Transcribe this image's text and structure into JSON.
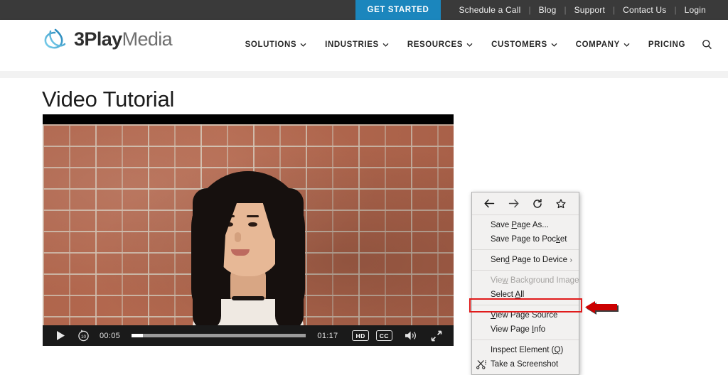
{
  "topbar": {
    "cta_label": "GET STARTED",
    "cta_color": "#1b86bd",
    "background": "#3a3a3a",
    "links": [
      "Schedule a Call",
      "Blog",
      "Support",
      "Contact Us",
      "Login"
    ],
    "separator": "|"
  },
  "header": {
    "logo": {
      "bold_text": "3Play",
      "light_text": "Media",
      "mark_icon": "3play-swirl-logo-icon",
      "mark_color": "#29a3d9"
    },
    "nav": [
      {
        "label": "SOLUTIONS",
        "has_dropdown": true
      },
      {
        "label": "INDUSTRIES",
        "has_dropdown": true
      },
      {
        "label": "RESOURCES",
        "has_dropdown": true
      },
      {
        "label": "CUSTOMERS",
        "has_dropdown": true
      },
      {
        "label": "COMPANY",
        "has_dropdown": true
      },
      {
        "label": "PRICING",
        "has_dropdown": false
      }
    ],
    "chevron_icon": "chevron-down-icon",
    "search_icon": "search-icon"
  },
  "main": {
    "page_title": "Video Tutorial"
  },
  "player": {
    "play_icon": "play-icon",
    "rewind_icon": "rewind-10-icon",
    "current_time": "00:05",
    "duration": "01:17",
    "progress_percent": 6.5,
    "hd_label": "HD",
    "cc_label": "CC",
    "volume_icon": "volume-on-icon",
    "fullscreen_icon": "fullscreen-icon"
  },
  "context_menu": {
    "nav_icons": [
      {
        "name": "back-icon",
        "glyph": "back"
      },
      {
        "name": "forward-icon",
        "glyph": "forward"
      },
      {
        "name": "reload-icon",
        "glyph": "reload"
      },
      {
        "name": "bookmark-star-icon",
        "glyph": "star"
      }
    ],
    "groups": [
      [
        {
          "label": "Save Page As...",
          "accesskey": "P",
          "disabled": false,
          "submenu": false,
          "icon": null
        },
        {
          "label": "Save Page to Pocket",
          "accesskey": "k",
          "disabled": false,
          "submenu": false,
          "icon": null
        }
      ],
      [
        {
          "label": "Send Page to Device",
          "accesskey": "d",
          "disabled": false,
          "submenu": true,
          "icon": null
        }
      ],
      [
        {
          "label": "View Background Image",
          "accesskey": "w",
          "disabled": true,
          "submenu": false,
          "icon": null
        },
        {
          "label": "Select All",
          "accesskey": "A",
          "disabled": false,
          "submenu": false,
          "icon": null
        }
      ],
      [
        {
          "label": "View Page Source",
          "accesskey": "V",
          "disabled": false,
          "submenu": false,
          "icon": null
        },
        {
          "label": "View Page Info",
          "accesskey": "I",
          "disabled": false,
          "submenu": false,
          "icon": null,
          "highlighted": true
        }
      ],
      [
        {
          "label": "Inspect Element (Q)",
          "accesskey": "Q",
          "disabled": false,
          "submenu": false,
          "icon": null
        },
        {
          "label": "Take a Screenshot",
          "accesskey": null,
          "disabled": false,
          "submenu": false,
          "icon": "screenshot-scissors-icon"
        }
      ]
    ]
  },
  "annotation": {
    "highlight_color": "#e01b1b",
    "arrow_icon": "left-arrow-annotation-icon",
    "arrow_color": "#cc0000",
    "target_label": "View Page Info"
  }
}
